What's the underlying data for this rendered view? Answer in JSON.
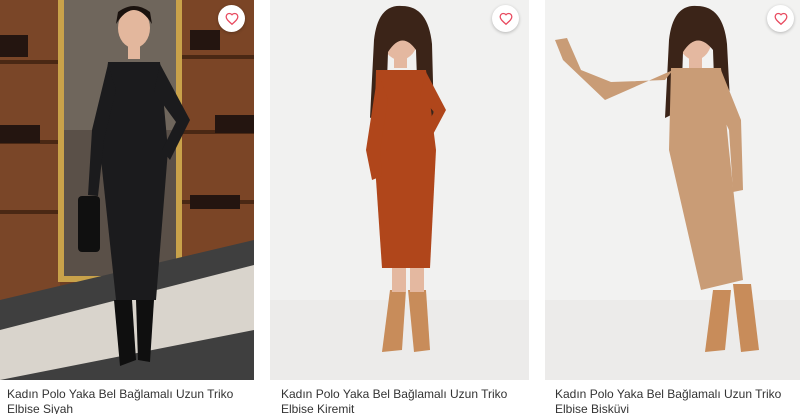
{
  "accent_color": "#e84a5f",
  "products": [
    {
      "title_line1": "Kadın Polo Yaka Bel Bağlamalı Uzun Triko",
      "title_line2": "Elbise Siyah",
      "dress_color": "#1b1b1d",
      "favorite_icon": "heart-outline-icon"
    },
    {
      "title_line1": "Kadın Polo Yaka Bel Bağlamalı Uzun Triko",
      "title_line2": "Elbise Kiremit",
      "dress_color": "#b0461b",
      "favorite_icon": "heart-outline-icon"
    },
    {
      "title_line1": "Kadın Polo Yaka Bel Bağlamalı Uzun Triko",
      "title_line2": "Elbise Bisküvi",
      "dress_color": "#c99c76",
      "favorite_icon": "heart-outline-icon"
    }
  ]
}
